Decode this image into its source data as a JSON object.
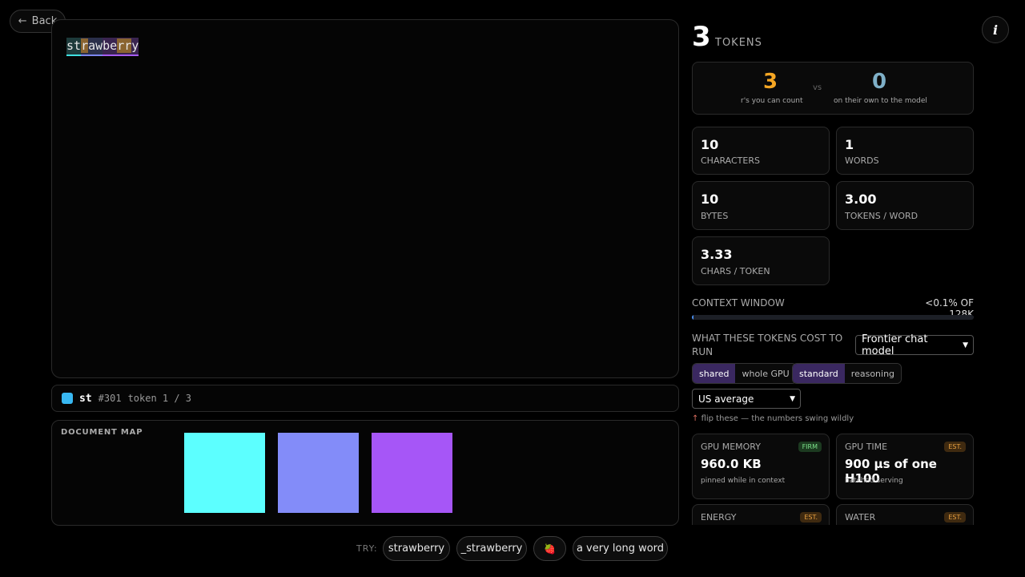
{
  "nav": {
    "back_label": "Back"
  },
  "editor": {
    "tokens": [
      {
        "text": "st",
        "id": "#301"
      },
      {
        "text": "raw",
        "id": ""
      },
      {
        "text": "berry",
        "id": ""
      }
    ]
  },
  "token_info": {
    "name": "st",
    "id": "#301",
    "position": "token 1 / 3"
  },
  "document_map": {
    "label": "DOCUMENT MAP",
    "colors": [
      "#5cffff",
      "#838cf9",
      "#a656f7"
    ]
  },
  "try": {
    "label": "TRY:",
    "options": [
      "strawberry",
      "_strawberry",
      "🍓",
      "a very long word"
    ]
  },
  "summary": {
    "count": "3",
    "label": "TOKENS"
  },
  "comparison": {
    "left_value": "3",
    "left_label": "r's you can count",
    "vs": "vs",
    "right_value": "0",
    "right_label": "on their own to the model",
    "left_color": "#f5a623",
    "right_color": "#7fb0c8"
  },
  "stats": [
    {
      "value": "10",
      "label": "CHARACTERS"
    },
    {
      "value": "1",
      "label": "WORDS"
    },
    {
      "value": "10",
      "label": "BYTES"
    },
    {
      "value": "3.00",
      "label": "TOKENS / WORD"
    },
    {
      "value": "3.33",
      "label": "CHARS / TOKEN"
    }
  ],
  "context": {
    "label": "CONTEXT WINDOW",
    "value": "<0.1% OF 128K",
    "fill_fraction": 0.001
  },
  "cost": {
    "label": "WHAT THESE TOKENS COST TO RUN",
    "model_select": "Frontier chat model",
    "toggle1": [
      "shared",
      "whole GPU"
    ],
    "toggle2": [
      "standard",
      "reasoning"
    ],
    "region_select": "US average",
    "hint_arrow": "↑",
    "hint": "flip these — the numbers swing wildly"
  },
  "resources": [
    {
      "title": "GPU MEMORY",
      "badge": "FIRM",
      "value": "960.0 KB",
      "sub": "pinned while in context"
    },
    {
      "title": "GPU TIME",
      "badge": "EST.",
      "value": "900 µs of one H100",
      "sub": "batched serving"
    },
    {
      "title": "ENERGY",
      "badge": "EST.",
      "value": "",
      "sub": ""
    },
    {
      "title": "WATER",
      "badge": "EST.",
      "value": "",
      "sub": ""
    }
  ]
}
